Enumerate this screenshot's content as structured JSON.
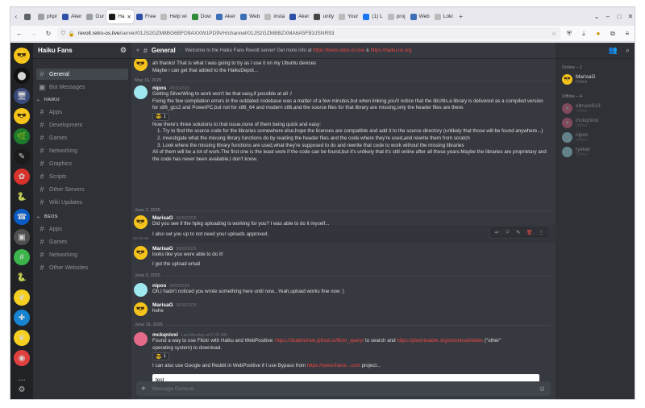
{
  "browser": {
    "tabs": [
      {
        "label": "",
        "icon": "tab-overview-icon",
        "color": "#5f6368"
      },
      {
        "label": "phpr",
        "icon": "page-icon",
        "color": "#9aa0a6"
      },
      {
        "label": "Aker",
        "icon": "hammer-icon",
        "color": "#2f4fa8"
      },
      {
        "label": "Our",
        "icon": "page-icon",
        "color": "#9aa0a6"
      },
      {
        "label": "Ha",
        "icon": "revolt-icon",
        "color": "#1b1b1b",
        "active": true
      },
      {
        "label": "Free",
        "icon": "hammer-icon",
        "color": "#2f4fa8"
      },
      {
        "label": "Help wi",
        "icon": "page-icon",
        "color": "#bbbbbb"
      },
      {
        "label": "Dow",
        "icon": "green-icon",
        "color": "#2e8b3a"
      },
      {
        "label": "Aker",
        "icon": "tile-icon",
        "color": "#3d6fb6"
      },
      {
        "label": "Web",
        "icon": "tile-icon",
        "color": "#3d6fb6"
      },
      {
        "label": "insta",
        "icon": "page-icon",
        "color": "#bbbbbb"
      },
      {
        "label": "Aker",
        "icon": "hammer-icon",
        "color": "#2f4fa8"
      },
      {
        "label": "unity",
        "icon": "unity-icon",
        "color": "#444444"
      },
      {
        "label": "Your",
        "icon": "page-icon",
        "color": "#bbbbbb"
      },
      {
        "label": "(1) L",
        "icon": "facebook-icon",
        "color": "#1877f2"
      },
      {
        "label": "proj",
        "icon": "page-icon",
        "color": "#bbbbbb"
      },
      {
        "label": "Web",
        "icon": "tile-icon",
        "color": "#3d6fb6"
      },
      {
        "label": "Loki",
        "icon": "page-icon",
        "color": "#bbbbbb"
      }
    ],
    "new_tab": "+",
    "dropdown": "⌄",
    "window_controls": [
      "–",
      "□",
      "✕"
    ],
    "url_host": "revolt.retro-os.live",
    "url_path": "/server/01JS2GZM8BG6BFD9AXXW1PD9VH/channel/01JS2GZMBBZXMA6A5FB3JSNR93"
  },
  "server": {
    "name": "Haiku Fans",
    "rail_servers": [
      {
        "name": "haiku-fans-server",
        "glyph": "😎",
        "bg": "#f5c518"
      },
      {
        "name": "server-2",
        "glyph": "⬤",
        "bg": "#111111"
      },
      {
        "name": "server-3",
        "glyph": "🖥",
        "bg": "#3a4a7a"
      },
      {
        "name": "server-4",
        "glyph": "😎",
        "bg": "#f5c518"
      },
      {
        "name": "server-5",
        "glyph": "🌿",
        "bg": "#1e7a2c"
      },
      {
        "name": "server-6",
        "glyph": "✎",
        "bg": "#1b1b1b"
      },
      {
        "name": "server-7",
        "glyph": "✿",
        "bg": "#d8322c"
      },
      {
        "name": "server-8",
        "glyph": "🐍",
        "bg": "#202225"
      },
      {
        "name": "server-9",
        "glyph": "☎",
        "bg": "#0a5bc4"
      },
      {
        "name": "server-10",
        "glyph": "▣",
        "bg": "#505050"
      },
      {
        "name": "server-11",
        "glyph": "#",
        "bg": "#3bb54a"
      },
      {
        "name": "server-12",
        "glyph": "🐍",
        "bg": "#202225"
      },
      {
        "name": "server-13",
        "glyph": "❦",
        "bg": "#f5d020"
      },
      {
        "name": "server-14",
        "glyph": "✚",
        "bg": "#1684d1"
      },
      {
        "name": "server-15",
        "glyph": "❦",
        "bg": "#f5d020"
      },
      {
        "name": "server-16",
        "glyph": "◉",
        "bg": "#e04040"
      },
      {
        "name": "server-17",
        "glyph": "…",
        "bg": "#202225"
      }
    ],
    "channels": [
      {
        "name": "General",
        "icon": "hash",
        "active": true
      },
      {
        "name": "Bot Messages",
        "icon": "bot"
      }
    ],
    "categories": [
      {
        "name": "HAIKU",
        "channels": [
          "Apps",
          "Development",
          "Games",
          "Networking",
          "Graphics",
          "Scripts",
          "Other Servers",
          "Wiki Updates"
        ]
      },
      {
        "name": "BEOS",
        "channels": [
          "Apps",
          "Games",
          "Networking",
          "Other Websites"
        ]
      }
    ]
  },
  "channel": {
    "name": "General",
    "topic_text": "Welcome to the Haiku Fans Revolt server! Get more info at",
    "topic_link1": "https://beos.retro-os.live",
    "topic_amp": "&",
    "topic_link2": "https://haiku-os.org"
  },
  "messages": {
    "m0_line1": "ah thanks! That is what I was going to try as I use it on my Ubuntu devices",
    "m0_line2": "Maybe i can get that added to the HaikuDepot...",
    "date1": "May 16, 2025",
    "m1_user": "nipos",
    "m1_ts": "05/16/2025",
    "m1_line1": "Getting SilverWing to work won't be that easy,if possible at all :/",
    "m1_para": "Fixing the few compilation errors in the outdated codebase was a matter of a few minutes,but when linking,you'll notice that the libUtils.a library is delivered as a compiled version for x86_gcc2 and PowerPC,but not for x86_64 and modern x86,and the source files for that library are missing,only the header files are there.",
    "m1_reaction": "1",
    "m1_line3": "Now there's three solutions to that issue,none of them being quick and easy:",
    "m1_sol1": "1. Try to find the source code for the libraries somewhere else,hope the licenses are compatible and add it to the source directory (unlikely that those will be found anywhere...)",
    "m1_sol2": "2. Investigate what the missing library functions do by reading the header files and the code where they're used,and rewrite them from scratch",
    "m1_sol3": "3. Look where the missing library functions are used,what they're supposed to do and rewrite that code to work without the missing libraries",
    "m1_line4": "All of them will be a lot of work.The first one is the least work if the code can be found,but it's unlikely that it's still online after all those years.Maybe the libraries are proprietary and the code has never been available,I don't know.",
    "date2": "June 2, 2025",
    "m2_user": "MarisaG",
    "m2_ts": "06/02/2025",
    "m2_line1": "Did you see if the hpkg uploading is working for you? I was able to do it myself...",
    "m2_hover_time": "09:13 AM",
    "m2_line2": "I also set you up to not need your uploads approved.",
    "m3_user": "MarisaG",
    "m3_ts": "06/02/2025",
    "m3_line1": "looks like you were able to do it!",
    "m3_line2": "I got the upload email",
    "date3": "June 3, 2025",
    "m4_user": "nipos",
    "m4_ts": "06/03/2025",
    "m4_line1": "Oh,I hadn't noticed you wrote something here until now...Yeah,upload works fine now :)",
    "m5_user": "MarisaG",
    "m5_ts": "06/03/2025",
    "m5_line1": "hehe",
    "date4": "June 16, 2025",
    "m6_user": "mckqnivxi",
    "m6_ts": "Last Monday at 07:01 AM",
    "m6_line1": "Found a way to use Flickr with Haiku and WebPositive:",
    "m6_link1": "https://2kabhishek.github.io/flickr_query/",
    "m6_mid": "to search and",
    "m6_link2": "https://jdownloader.org/download/index",
    "m6_tail": "(\"other\"",
    "m6_line2": "operating system) to download.",
    "m6_reaction": "1",
    "m6_line3_start": "I can also use Google and Reddit in WebPositive if I use Bypass from",
    "m6_line3_link": "https://www.frame...com",
    "m6_line3_end": "project..."
  },
  "hover_tools": [
    "↩",
    "☺",
    "✎",
    "🗑",
    "⋮"
  ],
  "composer": {
    "typed": "test",
    "placeholder": "Message General",
    "add": "+",
    "emoji": "☺"
  },
  "members": {
    "online_header": "Online – 1",
    "offline_header": "Offline – 4",
    "online": [
      {
        "name": "MarisaG",
        "status": "Online",
        "glyph": "😎",
        "bg": "#f5c518"
      }
    ],
    "offline": [
      {
        "name": "ebruce613",
        "status": "Offline",
        "glyph": "●",
        "bg": "#e46a8a"
      },
      {
        "name": "mckqnivxi",
        "status": "Offline",
        "glyph": "●",
        "bg": "#e46a8a"
      },
      {
        "name": "nipos",
        "status": "Offline",
        "glyph": "●",
        "bg": "#a0e8ef"
      },
      {
        "name": "ryebel",
        "status": "Offline",
        "glyph": "●",
        "bg": "#a0e8ef"
      }
    ]
  },
  "colors": {
    "accent_red": "#f04747",
    "link_blue": "#00b0f4",
    "online_green": "#3ba55c"
  }
}
